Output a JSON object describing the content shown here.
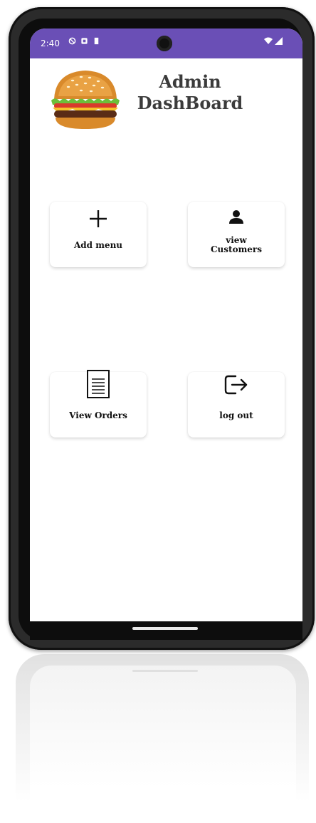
{
  "status_bar": {
    "time": "2:40",
    "icons_left": [
      "shield-icon",
      "sim-icon",
      "sd-card-icon"
    ],
    "icons_right": [
      "wifi-icon",
      "signal-icon"
    ],
    "color": "#6a4fb6"
  },
  "header": {
    "title_line1": "Admin",
    "title_line2": "DashBoard",
    "logo": "burger-icon"
  },
  "cards": {
    "add_menu": {
      "label": "Add menu",
      "icon": "plus-icon"
    },
    "view_customers": {
      "label_line1": "view",
      "label_line2": "Customers",
      "icon": "person-icon"
    },
    "view_orders": {
      "label": "View Orders",
      "icon": "document-list-icon"
    },
    "log_out": {
      "label": "log out",
      "icon": "logout-icon"
    }
  }
}
